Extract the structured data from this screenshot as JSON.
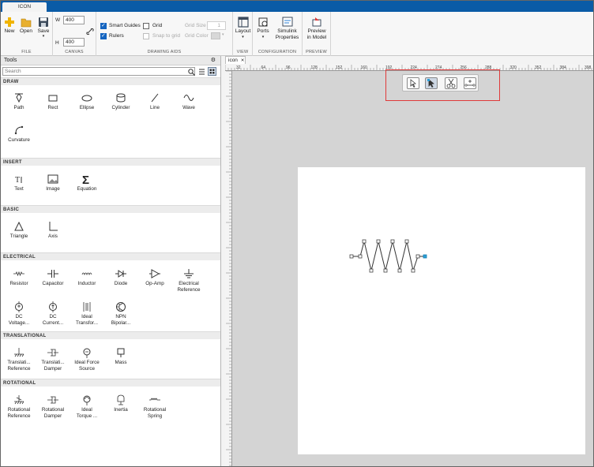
{
  "tabbar": {
    "active_tab": "ICON"
  },
  "ribbon": {
    "file": {
      "label": "FILE",
      "new": "New",
      "open": "Open",
      "save": "Save"
    },
    "canvas": {
      "label": "CANVAS",
      "w_label": "W",
      "w_value": "400",
      "h_label": "H",
      "h_value": "400"
    },
    "drawing_aids": {
      "label": "DRAWING AIDS",
      "smart_guides": "Smart Guides",
      "grid": "Grid",
      "rulers": "Rulers",
      "snap_to_grid": "Snap to grid",
      "grid_size": "Grid Size",
      "grid_size_value": "1",
      "grid_color": "Grid Color"
    },
    "view": {
      "label": "VIEW",
      "layout": "Layout"
    },
    "configuration": {
      "label": "CONFIGURATION",
      "ports": "Ports",
      "simulink_properties_1": "Simulink",
      "simulink_properties_2": "Properties"
    },
    "preview": {
      "label": "PREVIEW",
      "preview_1": "Preview",
      "preview_2": "in Model"
    }
  },
  "tools": {
    "title": "Tools",
    "search_placeholder": "Search",
    "categories": {
      "draw": "DRAW",
      "insert": "INSERT",
      "basic": "BASIC",
      "electrical": "ELECTRICAL",
      "translational": "TRANSLATIONAL",
      "rotational": "ROTATIONAL"
    },
    "draw_items": [
      "Path",
      "Rect",
      "Ellipse",
      "Cylinder",
      "Line",
      "Wave",
      "Curvature"
    ],
    "insert_items": [
      "Text",
      "Image",
      "Equation"
    ],
    "basic_items": [
      "Triangle",
      "Axis"
    ],
    "electrical_items": [
      [
        "Resistor"
      ],
      [
        "Capacitor"
      ],
      [
        "Inductor"
      ],
      [
        "Diode"
      ],
      [
        "Op-Amp"
      ],
      [
        "Electrical",
        "Reference"
      ],
      [
        "DC",
        "Voltage..."
      ],
      [
        "DC",
        "Current..."
      ],
      [
        "Ideal",
        "Transfor..."
      ],
      [
        "NPN",
        "Bipolar..."
      ]
    ],
    "translational_items": [
      [
        "Translati...",
        "Reference"
      ],
      [
        "Translati...",
        "Damper"
      ],
      [
        "Ideal Force",
        "Source"
      ],
      [
        "Mass"
      ]
    ],
    "rotational_items": [
      [
        "Rotational",
        "Reference"
      ],
      [
        "Rotational",
        "Damper"
      ],
      [
        "Ideal",
        "Torque ..."
      ],
      [
        "Inertia"
      ],
      [
        "Rotational",
        "Spring"
      ]
    ]
  },
  "document": {
    "tab": "icon",
    "ruler_ticks": [
      "32",
      "64",
      "96",
      "128",
      "152",
      "160",
      "192",
      "224",
      "274",
      "256",
      "288",
      "320",
      "352",
      "384",
      "398"
    ]
  },
  "colors": {
    "accent": "#0a5ba6",
    "highlight": "#e03a3a",
    "port": "#2aa0d8"
  }
}
